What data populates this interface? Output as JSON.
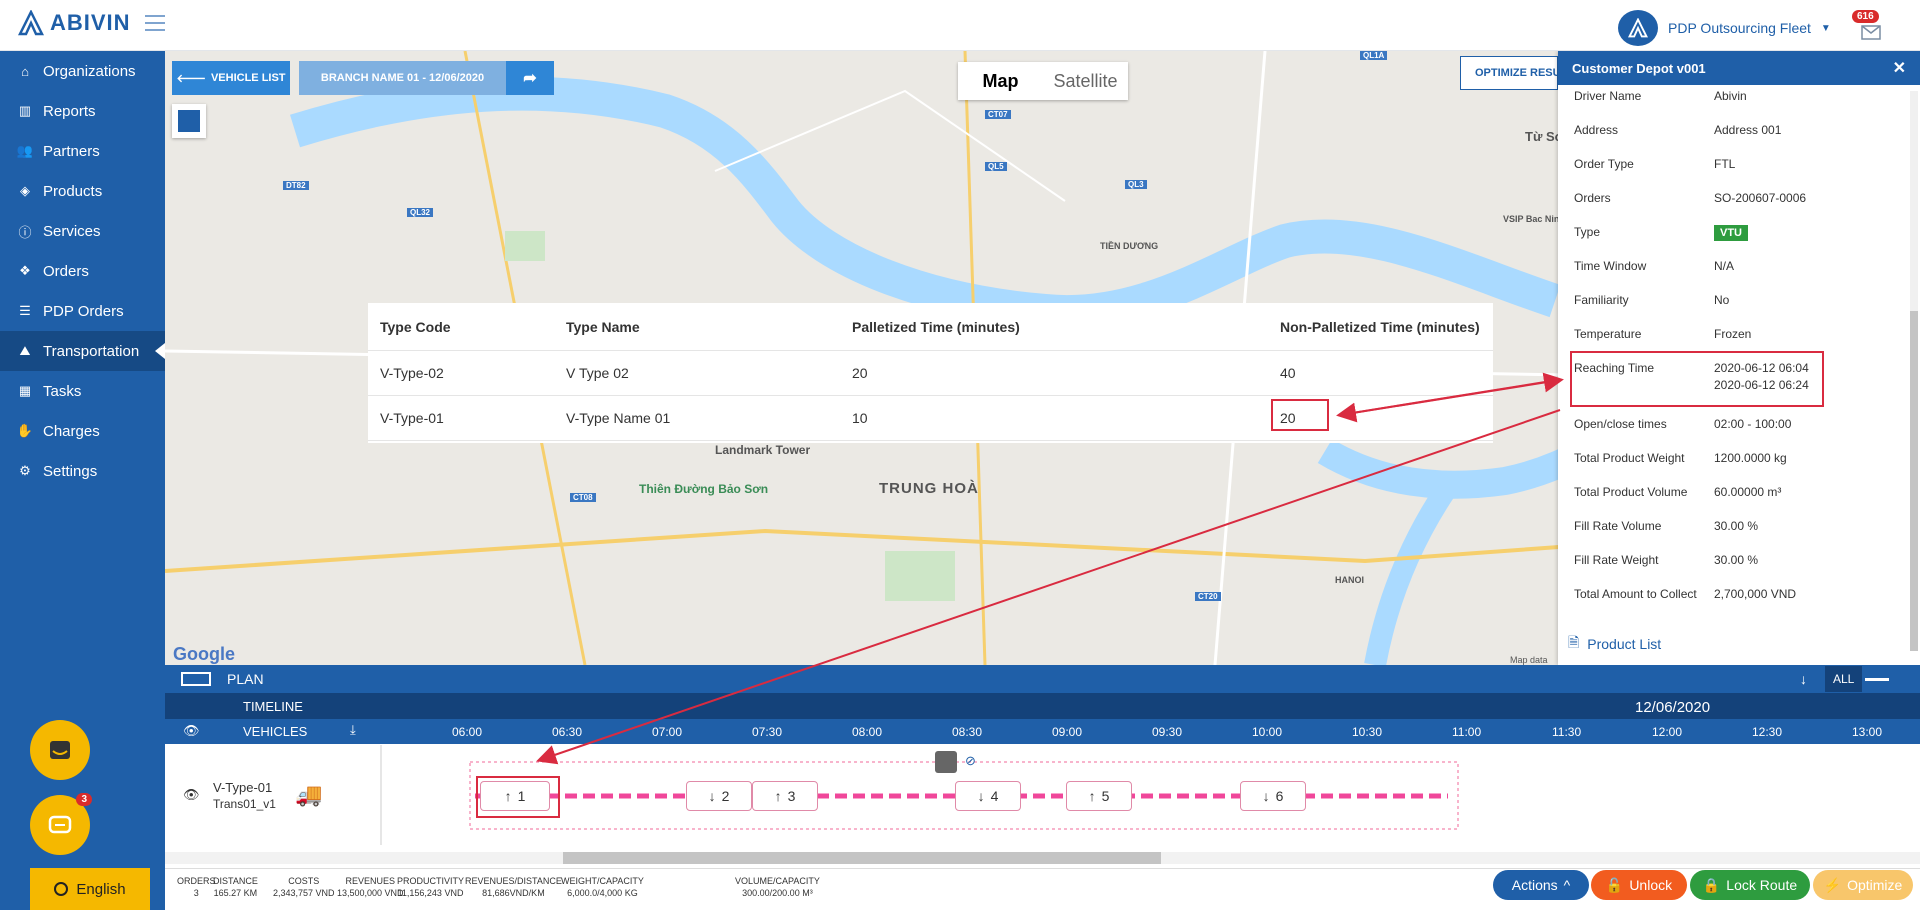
{
  "brand": {
    "name": "ABIVIN"
  },
  "user": {
    "name": "PDP Outsourcing Fleet",
    "notif": "616"
  },
  "sidebar": {
    "items": [
      {
        "label": "Organizations",
        "icon": "building-icon"
      },
      {
        "label": "Reports",
        "icon": "chart-icon"
      },
      {
        "label": "Partners",
        "icon": "users-icon"
      },
      {
        "label": "Products",
        "icon": "box-icon"
      },
      {
        "label": "Services",
        "icon": "info-icon"
      },
      {
        "label": "Orders",
        "icon": "cubes-icon"
      },
      {
        "label": "PDP Orders",
        "icon": "list-icon"
      },
      {
        "label": "Transportation",
        "icon": "road-icon"
      },
      {
        "label": "Tasks",
        "icon": "calendar-icon"
      },
      {
        "label": "Charges",
        "icon": "hand-coin-icon"
      },
      {
        "label": "Settings",
        "icon": "gear-icon"
      }
    ]
  },
  "chat_badge": "3",
  "language": "English",
  "toolbar": {
    "vehicle_list": "VEHICLE LIST",
    "branch": "BRANCH NAME 01 - 12/06/2020",
    "optimize": "OPTIMIZE RESULT"
  },
  "map": {
    "tab_map": "Map",
    "tab_satellite": "Satellite",
    "google": "Google",
    "mapdata": "Map data"
  },
  "type_table": {
    "headers": [
      "Type Code",
      "Type Name",
      "Palletized Time (minutes)",
      "Non-Palletized Time (minutes)"
    ],
    "rows": [
      [
        "V-Type-02",
        "V Type 02",
        "20",
        "40"
      ],
      [
        "V-Type-01",
        "V-Type Name 01",
        "10",
        "20"
      ]
    ]
  },
  "panel": {
    "title": "Customer Depot v001",
    "rows": [
      {
        "k": "Driver Name",
        "v": "Abivin"
      },
      {
        "k": "Address",
        "v": "Address 001"
      },
      {
        "k": "Order Type",
        "v": "FTL"
      },
      {
        "k": "Orders",
        "v": "SO-200607-0006"
      },
      {
        "k": "Type",
        "v": "VTU"
      },
      {
        "k": "Time Window",
        "v": "N/A"
      },
      {
        "k": "Familiarity",
        "v": "No"
      },
      {
        "k": "Temperature",
        "v": "Frozen"
      },
      {
        "k": "Reaching Time",
        "v": "2020-06-12 06:04",
        "v2": "2020-06-12 06:24"
      },
      {
        "k": "Open/close times",
        "v": "02:00 - 100:00"
      },
      {
        "k": "Total Product Weight",
        "v": "1200.0000 kg"
      },
      {
        "k": "Total Product Volume",
        "v": "60.00000 m³"
      },
      {
        "k": "Fill Rate Volume",
        "v": "30.00 %"
      },
      {
        "k": "Fill Rate Weight",
        "v": "30.00 %"
      },
      {
        "k": "Total Amount to Collect",
        "v": "2,700,000 VND"
      }
    ],
    "product_list": "Product List"
  },
  "plan": {
    "label": "PLAN",
    "all": "ALL",
    "timeline": "TIMELINE",
    "vehicles": "VEHICLES",
    "date": "12/06/2020",
    "times": [
      "06:00",
      "06:30",
      "07:00",
      "07:30",
      "08:00",
      "08:30",
      "09:00",
      "09:30",
      "10:00",
      "10:30",
      "11:00",
      "11:30",
      "12:00",
      "12:30",
      "13:00"
    ]
  },
  "vehicle": {
    "name": "V-Type-01",
    "route": "Trans01_v1"
  },
  "stops": [
    {
      "dir": "↑",
      "n": "1"
    },
    {
      "dir": "↓",
      "n": "2"
    },
    {
      "dir": "↑",
      "n": "3"
    },
    {
      "dir": "↓",
      "n": "4"
    },
    {
      "dir": "↑",
      "n": "5"
    },
    {
      "dir": "↓",
      "n": "6"
    }
  ],
  "stats": [
    {
      "k": "ORDERS",
      "v": "3"
    },
    {
      "k": "DISTANCE",
      "v": "165.27 KM"
    },
    {
      "k": "COSTS",
      "v": "2,343,757 VND"
    },
    {
      "k": "REVENUES",
      "v": "13,500,000 VND"
    },
    {
      "k": "PRODUCTIVITY",
      "v": "11,156,243 VND"
    },
    {
      "k": "REVENUES/DISTANCE",
      "v": "81,686VND/KM"
    },
    {
      "k": "WEIGHT/CAPACITY",
      "v": "6,000.0/4,000 KG"
    },
    {
      "k": "VOLUME/CAPACITY",
      "v": "300.00/200.00 M³"
    }
  ],
  "actions": {
    "actions": "Actions",
    "unlock": "Unlock",
    "lock": "Lock Route",
    "optimize": "Optimize"
  },
  "colors": {
    "primary": "#1f5fa8",
    "highlight": "#d92b40",
    "accent": "#f5b800"
  }
}
